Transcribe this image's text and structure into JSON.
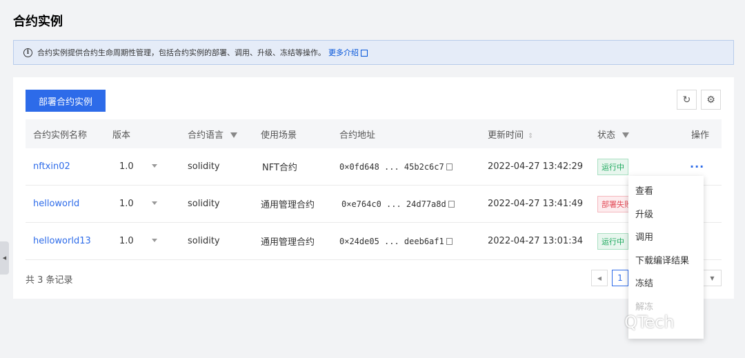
{
  "page": {
    "title": "合约实例"
  },
  "notice": {
    "text": "合约实例提供合约生命周期性管理，包括合约实例的部署、调用、升级、冻结等操作。",
    "link": "更多介绍"
  },
  "toolbar": {
    "deploy_label": "部署合约实例",
    "refresh_icon": "refresh-icon",
    "settings_icon": "gear-icon"
  },
  "table": {
    "headers": {
      "name": "合约实例名称",
      "version": "版本",
      "language": "合约语言",
      "scene": "使用场景",
      "address": "合约地址",
      "updated": "更新时间",
      "status": "状态",
      "action": "操作"
    },
    "rows": [
      {
        "name": "nftxin02",
        "version": "1.0",
        "language": "solidity",
        "scene": "NFT合约",
        "address": "0×0fd648 ... 45b2c6c7",
        "updated": "2022-04-27 13:42:29",
        "status": "运行中"
      },
      {
        "name": "helloworld",
        "version": "1.0",
        "language": "solidity",
        "scene": "通用管理合约",
        "address": "0×e764c0 ... 24d77a8d",
        "updated": "2022-04-27 13:41:49",
        "status": "部署失败"
      },
      {
        "name": "helloworld13",
        "version": "1.0",
        "language": "solidity",
        "scene": "通用管理合约",
        "address": "0×24de05 ... deeb6af1",
        "updated": "2022-04-27 13:01:34",
        "status": "运行中"
      }
    ]
  },
  "footer": {
    "count": "共 3 条记录",
    "page": "1"
  },
  "menu": {
    "items": [
      "查看",
      "升级",
      "调用",
      "下载编译结果",
      "冻结",
      "解冻"
    ]
  },
  "watermark": "QTech",
  "colors": {
    "primary": "#2d6be9",
    "success": "#1ba85c",
    "danger": "#e34d59"
  }
}
